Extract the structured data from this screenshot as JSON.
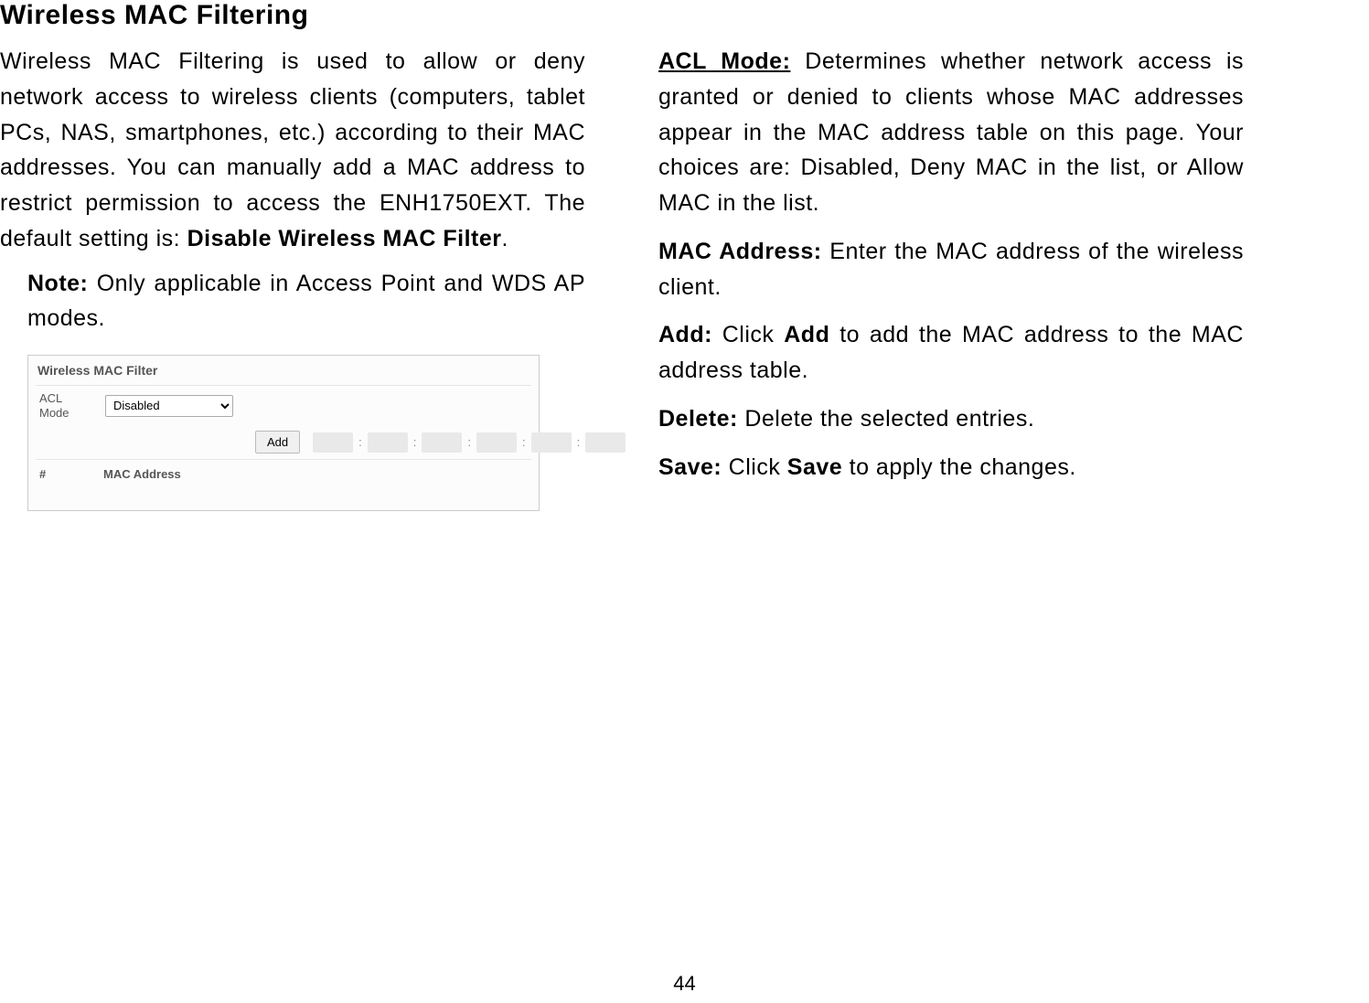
{
  "title": "Wireless MAC Filtering",
  "left": {
    "para_pre": "Wireless MAC Filtering is used to allow or deny network access to wireless clients (computers, tablet PCs, NAS, smartphones, etc.) according to their MAC addresses. You can manually add a MAC address to restrict permission to access the ENH1750EXT. The default setting is: ",
    "para_bold": "Disable Wireless MAC Filter",
    "para_post": ".",
    "note_label": "Note:",
    "note_text": "  Only applicable in Access Point and WDS AP modes."
  },
  "fig": {
    "title": "Wireless MAC Filter",
    "acl_label": "ACL Mode",
    "acl_select_value": "Disabled",
    "add_button": "Add",
    "hash": "#",
    "mac_header": "MAC Address"
  },
  "right": {
    "acl_label": "ACL Mode:",
    "acl_text": " Determines whether network access is granted or denied to clients whose MAC addresses appear in the MAC address table on this page. Your choices are: Disabled, Deny MAC in the list, or Allow MAC in the list.",
    "mac_label": "MAC Address:",
    "mac_text": " Enter the MAC address of the wireless client.",
    "add_label": "Add:",
    "add_pre": " Click ",
    "add_bold": "Add",
    "add_post": " to add the MAC address to the MAC address table.",
    "del_label": "Delete:",
    "del_text": " Delete the selected entries.",
    "save_label": "Save:",
    "save_pre": " Click ",
    "save_bold": "Save",
    "save_post": " to apply the changes."
  },
  "page_number": "44"
}
